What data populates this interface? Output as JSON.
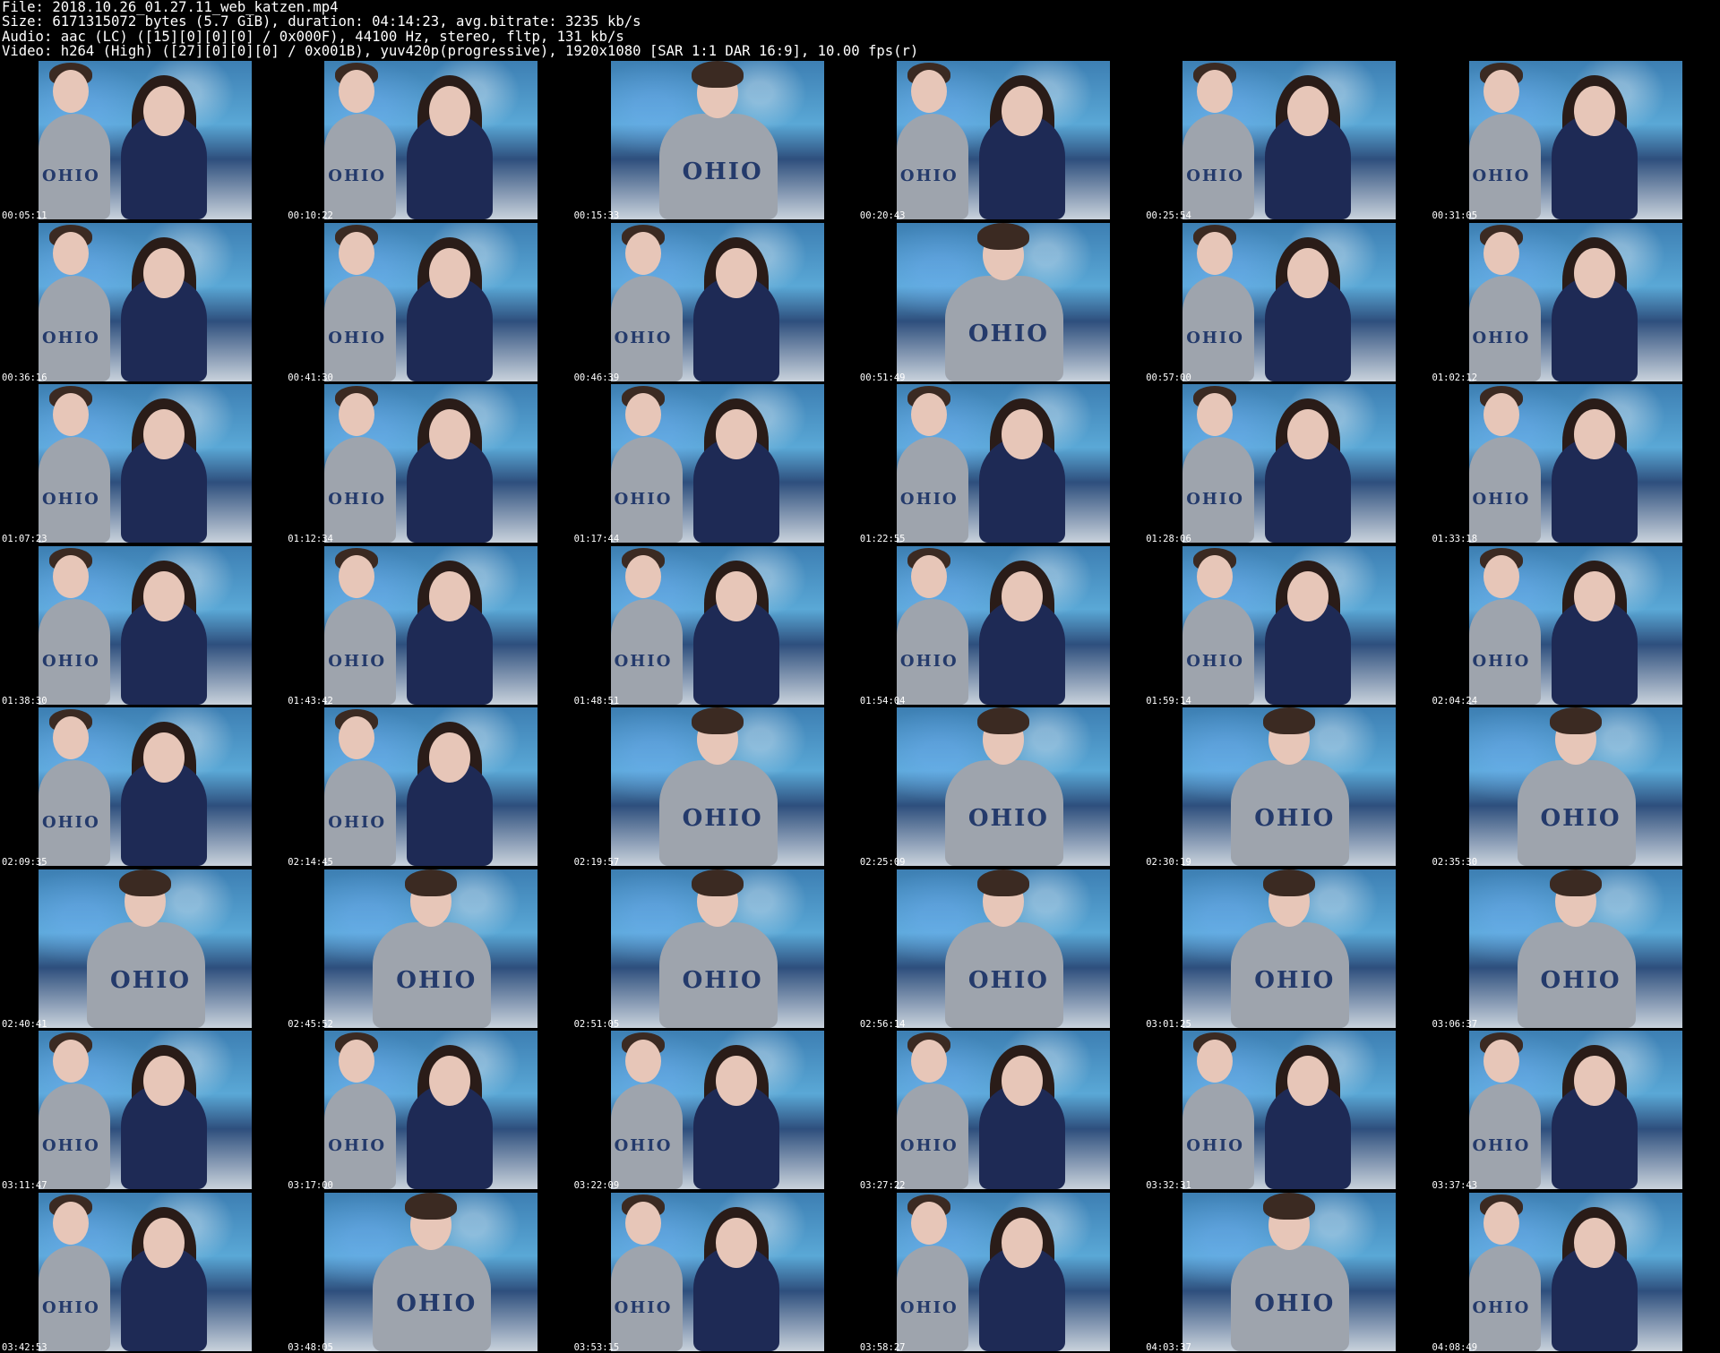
{
  "header": {
    "file": "File: 2018.10.26_01.27.11_web_katzen.mp4",
    "size": "Size: 6171315072 bytes (5.7 GiB), duration: 04:14:23, avg.bitrate: 3235 kb/s",
    "audio": "Audio: aac (LC) ([15][0][0][0] / 0x000F), 44100 Hz, stereo, fltp, 131 kb/s",
    "video": "Video: h264 (High) ([27][0][0][0] / 0x001B), yuv420p(progressive), 1920x1080 [SAR 1:1 DAR 16:9], 10.00 fps(r)"
  },
  "thumb_print": "OHIO",
  "thumbnails": [
    {
      "time": "00:05:11",
      "scene": "woman"
    },
    {
      "time": "00:10:22",
      "scene": "woman"
    },
    {
      "time": "00:15:33",
      "scene": "man"
    },
    {
      "time": "00:20:43",
      "scene": "woman"
    },
    {
      "time": "00:25:54",
      "scene": "woman"
    },
    {
      "time": "00:31:05",
      "scene": "woman"
    },
    {
      "time": "00:36:16",
      "scene": "woman"
    },
    {
      "time": "00:41:30",
      "scene": "woman"
    },
    {
      "time": "00:46:39",
      "scene": "woman"
    },
    {
      "time": "00:51:49",
      "scene": "man"
    },
    {
      "time": "00:57:00",
      "scene": "woman"
    },
    {
      "time": "01:02:12",
      "scene": "woman"
    },
    {
      "time": "01:07:23",
      "scene": "woman"
    },
    {
      "time": "01:12:34",
      "scene": "woman"
    },
    {
      "time": "01:17:44",
      "scene": "woman"
    },
    {
      "time": "01:22:55",
      "scene": "woman"
    },
    {
      "time": "01:28:06",
      "scene": "woman"
    },
    {
      "time": "01:33:18",
      "scene": "woman"
    },
    {
      "time": "01:38:30",
      "scene": "woman"
    },
    {
      "time": "01:43:42",
      "scene": "woman"
    },
    {
      "time": "01:48:51",
      "scene": "woman"
    },
    {
      "time": "01:54:04",
      "scene": "woman"
    },
    {
      "time": "01:59:14",
      "scene": "woman"
    },
    {
      "time": "02:04:24",
      "scene": "woman"
    },
    {
      "time": "02:09:35",
      "scene": "woman"
    },
    {
      "time": "02:14:45",
      "scene": "woman"
    },
    {
      "time": "02:19:57",
      "scene": "man"
    },
    {
      "time": "02:25:09",
      "scene": "man"
    },
    {
      "time": "02:30:19",
      "scene": "man"
    },
    {
      "time": "02:35:30",
      "scene": "man"
    },
    {
      "time": "02:40:41",
      "scene": "man"
    },
    {
      "time": "02:45:52",
      "scene": "man"
    },
    {
      "time": "02:51:05",
      "scene": "man"
    },
    {
      "time": "02:56:14",
      "scene": "man"
    },
    {
      "time": "03:01:25",
      "scene": "man"
    },
    {
      "time": "03:06:37",
      "scene": "man"
    },
    {
      "time": "03:11:47",
      "scene": "woman"
    },
    {
      "time": "03:17:00",
      "scene": "woman"
    },
    {
      "time": "03:22:09",
      "scene": "woman"
    },
    {
      "time": "03:27:22",
      "scene": "woman"
    },
    {
      "time": "03:32:31",
      "scene": "woman"
    },
    {
      "time": "03:37:43",
      "scene": "woman"
    },
    {
      "time": "03:42:53",
      "scene": "woman"
    },
    {
      "time": "03:48:05",
      "scene": "man"
    },
    {
      "time": "03:53:15",
      "scene": "woman"
    },
    {
      "time": "03:58:27",
      "scene": "woman"
    },
    {
      "time": "04:03:37",
      "scene": "man"
    },
    {
      "time": "04:08:49",
      "scene": "woman"
    }
  ]
}
